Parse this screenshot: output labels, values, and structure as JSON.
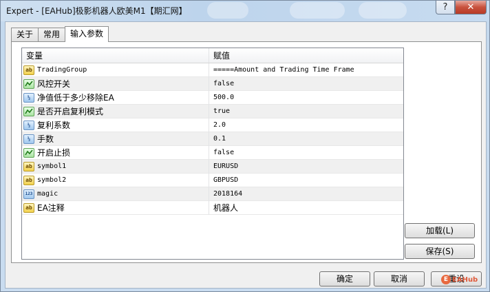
{
  "window": {
    "title": "Expert - [EAHub]极影机器人欧美M1【期汇网】",
    "help_label": "?",
    "close_label": "✕"
  },
  "tabs": [
    {
      "label": "关于",
      "active": false
    },
    {
      "label": "常用",
      "active": false
    },
    {
      "label": "输入参数",
      "active": true
    }
  ],
  "grid": {
    "col_variable": "变量",
    "col_value": "赋值",
    "rows": [
      {
        "icon": "ab",
        "name": "TradingGroup",
        "value": "=====Amount and Trading Time Frame"
      },
      {
        "icon": "bool",
        "name": "风控开关",
        "value": "false"
      },
      {
        "icon": "double",
        "name": "净值低于多少移除EA",
        "value": "500.0"
      },
      {
        "icon": "bool",
        "name": "是否开启复利模式",
        "value": "true"
      },
      {
        "icon": "double",
        "name": "复利系数",
        "value": "2.0"
      },
      {
        "icon": "double",
        "name": "手数",
        "value": "0.1"
      },
      {
        "icon": "bool",
        "name": "开启止损",
        "value": "false"
      },
      {
        "icon": "ab",
        "name": "symbol1",
        "value": "EURUSD"
      },
      {
        "icon": "ab",
        "name": "symbol2",
        "value": "GBPUSD"
      },
      {
        "icon": "int",
        "name": "magic",
        "value": "2018164"
      },
      {
        "icon": "ab",
        "name": "EA注释",
        "value": "机器人"
      }
    ]
  },
  "buttons": {
    "load": "加载(L)",
    "save": "保存(S)",
    "ok": "确定",
    "cancel": "取消",
    "reset": "重设"
  },
  "icon_glyphs": {
    "ab": "ab",
    "double": "½",
    "int": "123"
  },
  "watermark": {
    "text": "EAHub"
  }
}
